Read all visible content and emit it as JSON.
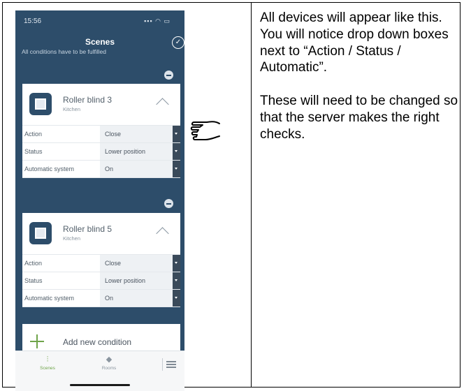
{
  "phone": {
    "status_time": "15:56",
    "status_icons": "▪▪▪ ◠ ▭",
    "title": "Scenes",
    "subtitle": "All conditions have to be fulfilled",
    "cards": [
      {
        "name": "Roller blind 3",
        "room": "Kitchen",
        "rows": [
          {
            "label": "Action",
            "value": "Close"
          },
          {
            "label": "Status",
            "value": "Lower position"
          },
          {
            "label": "Automatic system",
            "value": "On"
          }
        ]
      },
      {
        "name": "Roller blind 5",
        "room": "Kitchen",
        "rows": [
          {
            "label": "Action",
            "value": "Close"
          },
          {
            "label": "Status",
            "value": "Lower position"
          },
          {
            "label": "Automatic system",
            "value": "On"
          }
        ]
      }
    ],
    "add_condition": "Add new condition",
    "tabs": {
      "scenes": "Scenes",
      "rooms": "Rooms"
    }
  },
  "instructions": {
    "para1": "All devices will appear like this. You will notice drop down boxes next to “Action / Status / Automatic”.",
    "para2": "These will need to be changed so that the server makes the right checks."
  },
  "colors": {
    "app_bg": "#2d4d6a",
    "accent": "#6fa44a"
  }
}
